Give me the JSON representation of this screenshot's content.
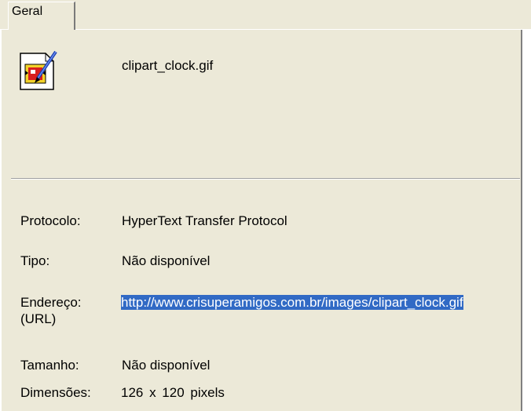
{
  "tabs": [
    {
      "label": "Geral",
      "active": true
    }
  ],
  "file": {
    "name": "clipart_clock.gif",
    "icon": "image-file-icon"
  },
  "properties": {
    "protocol_label": "Protocolo:",
    "protocol_value": "HyperText Transfer Protocol",
    "type_label": "Tipo:",
    "type_value": "Não disponível",
    "address_label_line1": "Endereço:",
    "address_label_line2": "(URL)",
    "address_value": "http://www.crisuperamigos.com.br/images/clipart_clock.gif",
    "size_label": "Tamanho:",
    "size_value": "Não disponível",
    "dimensions_label": "Dimensões:",
    "dimensions_value": "126 x 120 pixels"
  },
  "colors": {
    "panel_bg": "#ece9d8",
    "selection_bg": "#316ac5",
    "selection_text": "#ffffff"
  }
}
